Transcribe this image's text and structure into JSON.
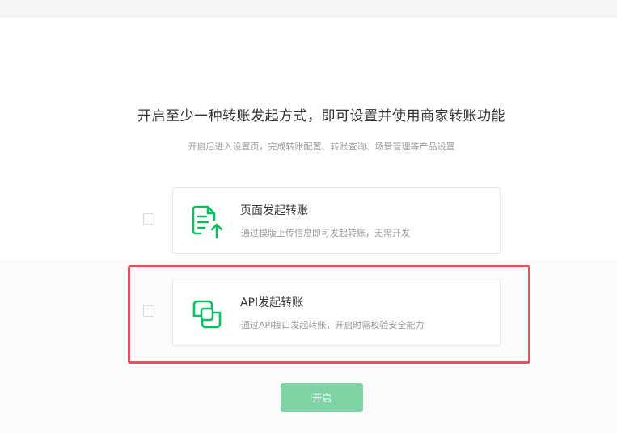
{
  "page": {
    "heading": "开启至少一种转账发起方式，即可设置并使用商家转账功能",
    "subheading": "开启后进入设置页，完成转账配置、转账查询、场景管理等产品设置"
  },
  "options": [
    {
      "title": "页面发起转账",
      "description": "通过模版上传信息即可发起转账，无需开发",
      "icon": "document-upload-icon",
      "checked": false
    },
    {
      "title": "API发起转账",
      "description": "通过API接口发起转账，开启时需校验安全能力",
      "icon": "api-transfer-icon",
      "checked": false,
      "highlighted": true
    }
  ],
  "actions": {
    "enable_label": "开启"
  },
  "colors": {
    "brand_green": "#07c160",
    "button_disabled_green": "#7fd3a4",
    "highlight_red": "#e85060"
  }
}
